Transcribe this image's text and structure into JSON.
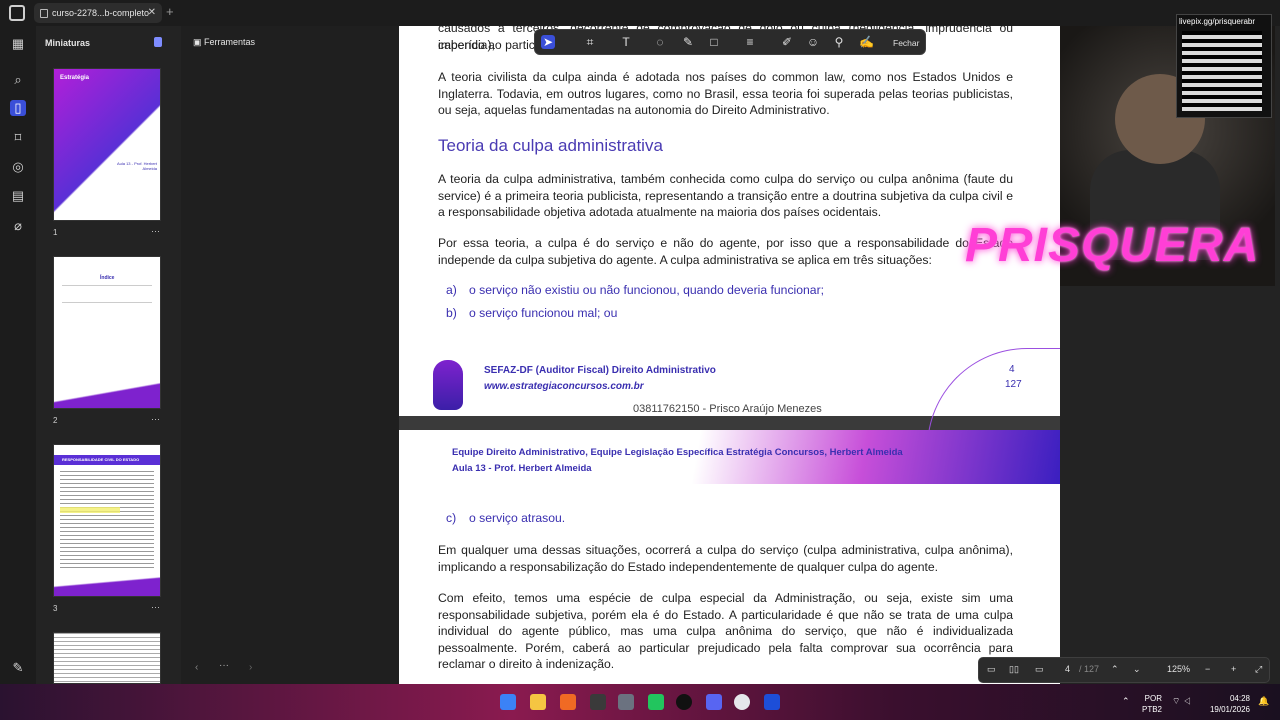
{
  "tab": {
    "title": "curso-2278...b-completo"
  },
  "sidebar": {
    "title": "Miniaturas",
    "thumbs": [
      {
        "num": "1"
      },
      {
        "num": "2"
      },
      {
        "num": "3"
      },
      {
        "num": ""
      }
    ]
  },
  "thumb1": {
    "brand": "Estratégia",
    "lesson": "Aula 13 - Prof. Herbert Almeida"
  },
  "thumb2": {
    "title": "Índice"
  },
  "thumb3": {
    "title": "RESPONSABILIDADE CIVIL DO ESTADO"
  },
  "tools": {
    "label": "Ferramentas"
  },
  "floatbar": {
    "close": "Fechar"
  },
  "page1": {
    "top_line": "causados a terceiros, decorrente de comprovação de dolo ou culpa (negligência, imprudência ou imperícia),",
    "top_line2": "cabendo ao particular o ônus da prova ... subjetivos.",
    "p1": "A teoria civilista da culpa ainda é adotada nos países do common law, como nos Estados Unidos e Inglaterra. Todavia, em outros lugares, como no Brasil, essa teoria foi superada pelas teorias publicistas, ou seja, aquelas fundamentadas na autonomia do Direito Administrativo.",
    "heading": "Teoria da culpa administrativa",
    "p2": "A teoria da culpa administrativa, também conhecida como culpa do serviço ou culpa anônima (faute du service) é a primeira teoria publicista, representando a transição entre a doutrina subjetiva da culpa civil e a responsabilidade objetiva adotada atualmente na maioria dos países ocidentais.",
    "p3": "Por essa teoria, a culpa é do serviço e não do agente, por isso que a responsabilidade do Estado independe da culpa subjetiva do agente. A culpa administrativa se aplica em três situações:",
    "item_a_marker": "a)",
    "item_a": "o serviço não existiu ou não funcionou, quando deveria funcionar;",
    "item_b_marker": "b)",
    "item_b": "o serviço funcionou mal; ou",
    "footer_course": "SEFAZ-DF (Auditor Fiscal) Direito Administrativo",
    "footer_site": "www.estrategiaconcursos.com.br",
    "footer_owner": "03811762150 - Prisco Araújo Menezes",
    "page_num": "4",
    "page_total": "127"
  },
  "page2": {
    "header1": "Equipe Direito Administrativo, Equipe Legislação Específica Estratégia Concursos, Herbert Almeida",
    "header2": "Aula 13 - Prof. Herbert Almeida",
    "item_c_marker": "c)",
    "item_c": "o serviço atrasou.",
    "p1": "Em qualquer uma dessas situações, ocorrerá a culpa do serviço (culpa administrativa, culpa anônima), implicando a responsabilização do Estado independentemente de qualquer culpa do agente.",
    "p2": "Com efeito, temos uma espécie de culpa especial da Administração, ou seja, existe sim uma responsabilidade subjetiva, porém ela é do Estado. A particularidade é que não se trata de uma culpa individual do agente público, mas uma culpa anônima do serviço, que não é individualizada pessoalmente. Porém, caberá ao particular prejudicado pela falta comprovar sua ocorrência para reclamar o direito à indenização."
  },
  "docctrl": {
    "page": "4",
    "total": "/ 127",
    "zoom": "125%"
  },
  "overlay": {
    "brand": "PRISQUERA",
    "qr_label": "livepix.gg/prisquerabr"
  },
  "taskbar": {
    "lang1": "POR",
    "lang2": "PTB2",
    "time": "04:28",
    "date": "19/01/2026"
  }
}
